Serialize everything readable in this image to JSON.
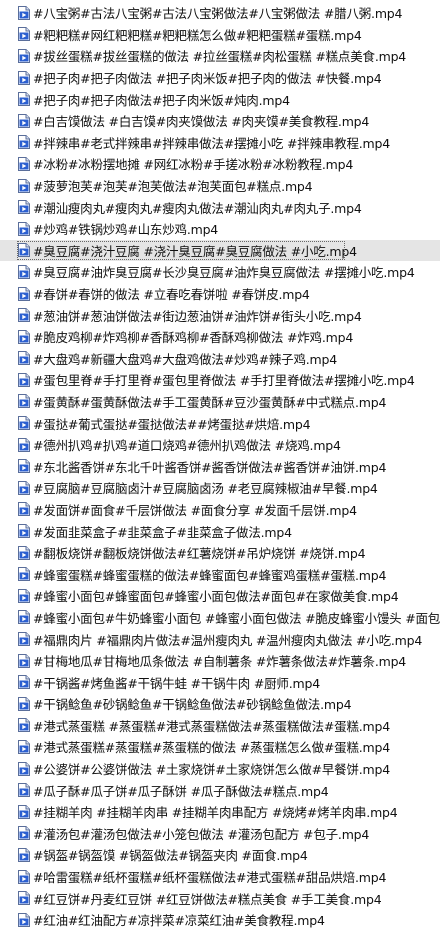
{
  "files": [
    {
      "name": "#八宝粥#古法八宝粥#古法八宝粥做法#八宝粥做法 #腊八粥.mp4"
    },
    {
      "name": "#粑粑糕#网红粑粑糕#粑粑糕怎么做#粑粑蛋糕#蛋糕.mp4"
    },
    {
      "name": "#拔丝蛋糕#拔丝蛋糕的做法 #拉丝蛋糕#肉松蛋糕 #糕点美食.mp4"
    },
    {
      "name": "#把子肉#把子肉做法 #把子肉米饭#把子肉的做法 #快餐.mp4"
    },
    {
      "name": "#把子肉#把子肉做法#把子肉米饭#炖肉.mp4"
    },
    {
      "name": "#白吉馍做法 #白吉馍#肉夹馍做法 #肉夹馍#美食教程.mp4"
    },
    {
      "name": "#拌辣串#老式拌辣串#拌辣串做法#摆摊小吃 #拌辣串教程.mp4"
    },
    {
      "name": "#冰粉#冰粉摆地摊 #网红冰粉#手搓冰粉#冰粉教程.mp4"
    },
    {
      "name": "#菠萝泡芙#泡芙#泡芙做法#泡芙面包#糕点.mp4"
    },
    {
      "name": "#潮汕瘦肉丸#瘦肉丸#瘦肉丸做法#潮汕肉丸#肉丸子.mp4"
    },
    {
      "name": "#炒鸡#铁锅炒鸡#山东炒鸡.mp4"
    },
    {
      "name": "#臭豆腐#浇汁豆腐 #浇汁臭豆腐#臭豆腐做法 #小吃.mp4",
      "selected": true
    },
    {
      "name": "#臭豆腐#油炸臭豆腐#长沙臭豆腐#油炸臭豆腐做法 #摆摊小吃.mp4"
    },
    {
      "name": "#春饼#春饼的做法 #立春吃春饼啦 #春饼皮.mp4"
    },
    {
      "name": "#葱油饼#葱油饼做法#街边葱油饼#油炸饼#街头小吃.mp4"
    },
    {
      "name": "#脆皮鸡柳#炸鸡柳#香酥鸡柳#香酥鸡柳做法 #炸鸡.mp4"
    },
    {
      "name": "#大盘鸡#新疆大盘鸡#大盘鸡做法#炒鸡#辣子鸡.mp4"
    },
    {
      "name": "#蛋包里脊#手打里脊#蛋包里脊做法 #手打里脊做法#摆摊小吃.mp4"
    },
    {
      "name": "#蛋黄酥#蛋黄酥做法#手工蛋黄酥#豆沙蛋黄酥#中式糕点.mp4"
    },
    {
      "name": "#蛋挞#葡式蛋挞#蛋挞做法##烤蛋挞#烘焙.mp4"
    },
    {
      "name": "#德州扒鸡#扒鸡#道口烧鸡#德州扒鸡做法 #烧鸡.mp4"
    },
    {
      "name": "#东北酱香饼#东北千叶酱香饼#酱香饼做法#酱香饼#油饼.mp4"
    },
    {
      "name": "#豆腐脑#豆腐脑卤汁#豆腐脑卤汤 #老豆腐辣椒油#早餐.mp4"
    },
    {
      "name": "#发面饼#面食#千层饼做法 #面食分享 #发面千层饼.mp4"
    },
    {
      "name": "#发面韭菜盒子#韭菜盒子#韭菜盒子做法.mp4"
    },
    {
      "name": "#翻板烧饼#翻板烧饼做法#红薯烧饼#吊炉烧饼 #烧饼.mp4"
    },
    {
      "name": "#蜂蜜蛋糕#蜂蜜蛋糕的做法#蜂蜜面包#蜂蜜鸡蛋糕#蛋糕.mp4"
    },
    {
      "name": "#蜂蜜小面包#蜂蜜面包#蜂蜜小面包做法#面包#在家做美食.mp4"
    },
    {
      "name": "#蜂蜜小面包#牛奶蜂蜜小面包 #蜂蜜小面包做法 #脆皮蜂蜜小馒头 #面包.mp4"
    },
    {
      "name": "#福鼎肉片 #福鼎肉片做法#温州瘦肉丸 #温州瘦肉丸做法 #小吃.mp4"
    },
    {
      "name": "#甘梅地瓜#甘梅地瓜条做法 #自制薯条 #炸薯条做法#炸薯条.mp4"
    },
    {
      "name": "#干锅酱#烤鱼酱#干锅牛蛙 #干锅牛肉 #厨师.mp4"
    },
    {
      "name": "#干锅鲶鱼#砂锅鲶鱼#干锅鲶鱼做法#砂锅鲶鱼做法.mp4"
    },
    {
      "name": "#港式蒸蛋糕 #蒸蛋糕#港式蒸蛋糕做法#蒸蛋糕做法#蛋糕.mp4"
    },
    {
      "name": "#港式蒸蛋糕#蒸蛋糕#蒸蛋糕的做法 #蒸蛋糕怎么做#蛋糕.mp4"
    },
    {
      "name": "#公婆饼#公婆饼做法 #土家烧饼#土家烧饼怎么做#早餐饼.mp4"
    },
    {
      "name": "#瓜子酥#瓜子饼#瓜子酥饼 #瓜子酥做法#糕点.mp4"
    },
    {
      "name": "#挂糊羊肉 #挂糊羊肉串 #挂糊羊肉串配方 #烧烤#烤羊肉串.mp4"
    },
    {
      "name": "#灌汤包#灌汤包做法#小笼包做法 #灌汤包配方 #包子.mp4"
    },
    {
      "name": "#锅盔#锅盔馍 #锅盔做法#锅盔夹肉 #面食.mp4"
    },
    {
      "name": "#哈雷蛋糕#纸杯蛋糕#纸杯蛋糕做法#港式蛋糕#甜品烘焙.mp4"
    },
    {
      "name": "#红豆饼#丹麦红豆饼 #红豆饼做法#糕点美食 #手工美食.mp4"
    },
    {
      "name": "#红油#红油配方#凉拌菜#凉菜红油#美食教程.mp4"
    }
  ],
  "colors": {
    "icon_blue": "#2b5fd0",
    "selected_bg": "#e5e5e5"
  },
  "icon": "video-file-icon"
}
